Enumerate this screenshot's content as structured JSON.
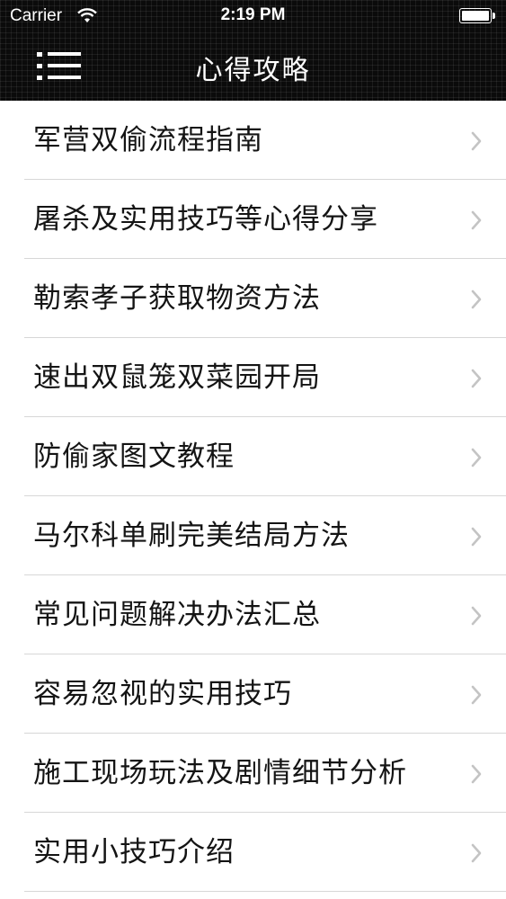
{
  "status_bar": {
    "carrier": "Carrier",
    "time": "2:19 PM",
    "battery_level": 1.0,
    "icons": [
      "wifi-icon",
      "battery-icon"
    ]
  },
  "nav": {
    "title": "心得攻略",
    "menu_icon": "menu-icon"
  },
  "list": {
    "chevron_icon": "chevron-right-icon",
    "items": [
      {
        "label": "军营双偷流程指南"
      },
      {
        "label": "屠杀及实用技巧等心得分享"
      },
      {
        "label": "勒索孝子获取物资方法"
      },
      {
        "label": "速出双鼠笼双菜园开局"
      },
      {
        "label": "防偷家图文教程"
      },
      {
        "label": "马尔科单刷完美结局方法"
      },
      {
        "label": "常见问题解决办法汇总"
      },
      {
        "label": "容易忽视的实用技巧"
      },
      {
        "label": "施工现场玩法及剧情细节分析"
      },
      {
        "label": "实用小技巧介绍"
      }
    ]
  },
  "colors": {
    "header_background": "#0b0b0b",
    "header_text": "#ffffff",
    "list_background": "#ffffff",
    "row_text": "#141414",
    "separator": "#d7d7d7",
    "chevron": "#c4c4c4"
  }
}
